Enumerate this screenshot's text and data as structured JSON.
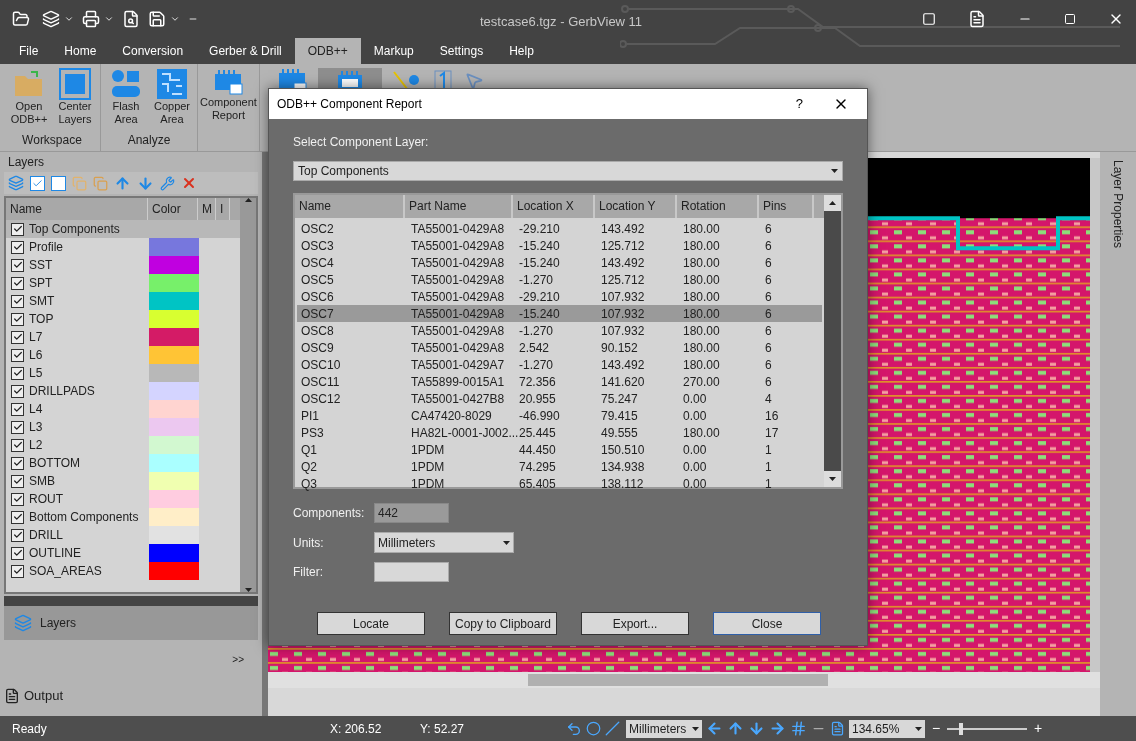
{
  "window": {
    "title": "testcase6.tgz - GerbView 11"
  },
  "ribbon_tabs": [
    {
      "label": "File",
      "selected": false
    },
    {
      "label": "Home",
      "selected": false
    },
    {
      "label": "Conversion",
      "selected": false
    },
    {
      "label": "Gerber & Drill",
      "selected": false
    },
    {
      "label": "ODB++",
      "selected": true
    },
    {
      "label": "Markup",
      "selected": false
    },
    {
      "label": "Settings",
      "selected": false
    },
    {
      "label": "Help",
      "selected": false
    }
  ],
  "ribbon_groups": [
    {
      "label": "Workspace",
      "buttons": [
        {
          "label": "Open ODB++"
        },
        {
          "label": "Center Layers"
        }
      ]
    },
    {
      "label": "Analyze",
      "buttons": [
        {
          "label": "Flash Area"
        },
        {
          "label": "Copper Area"
        }
      ]
    },
    {
      "buttons": [
        {
          "label": "Component Report"
        }
      ]
    }
  ],
  "ribbon_icon_buttons": [
    {
      "selected": false
    },
    {
      "selected": true
    },
    {
      "selected": false
    },
    {
      "selected": false
    },
    {
      "selected": false
    }
  ],
  "layers_panel": {
    "title": "Layers",
    "columns": [
      "Name",
      "Color",
      "M",
      "I"
    ],
    "rows": [
      {
        "name": "Top Components",
        "checked": true,
        "selected": true
      },
      {
        "name": "Profile",
        "checked": true,
        "selected": false,
        "color": "#7777dd"
      },
      {
        "name": "SST",
        "checked": true,
        "selected": false,
        "color": "#c000e0"
      },
      {
        "name": "SPT",
        "checked": true,
        "selected": false,
        "color": "#77f06a"
      },
      {
        "name": "SMT",
        "checked": true,
        "selected": false,
        "color": "#00c4c4"
      },
      {
        "name": "TOP",
        "checked": true,
        "selected": false,
        "color": "#d8ff30"
      },
      {
        "name": "L7",
        "checked": true,
        "selected": false,
        "color": "#d41b66"
      },
      {
        "name": "L6",
        "checked": true,
        "selected": false,
        "color": "#ffc435"
      },
      {
        "name": "L5",
        "checked": true,
        "selected": false,
        "color": "#b8b8b8"
      },
      {
        "name": "DRILLPADS",
        "checked": true,
        "selected": false,
        "color": "#d4d4ff"
      },
      {
        "name": "L4",
        "checked": true,
        "selected": false,
        "color": "#ffd4d0"
      },
      {
        "name": "L3",
        "checked": true,
        "selected": false,
        "color": "#ecc8f0"
      },
      {
        "name": "L2",
        "checked": true,
        "selected": false,
        "color": "#d2f8d0"
      },
      {
        "name": "BOTTOM",
        "checked": true,
        "selected": false,
        "color": "#aaffff"
      },
      {
        "name": "SMB",
        "checked": true,
        "selected": false,
        "color": "#f0ffb0"
      },
      {
        "name": "ROUT",
        "checked": true,
        "selected": false,
        "color": "#ffcce0"
      },
      {
        "name": "Bottom Components",
        "checked": true,
        "selected": false,
        "color": "#ffeec8"
      },
      {
        "name": "DRILL",
        "checked": true,
        "selected": false,
        "color": "#e2e2e2"
      },
      {
        "name": "OUTLINE",
        "checked": true,
        "selected": false,
        "color": "#0000ff"
      },
      {
        "name": "SOA_AREAS",
        "checked": true,
        "selected": false,
        "color": "#ff0000"
      }
    ]
  },
  "nav_panel": {
    "label": "Layers",
    "more": ">>"
  },
  "output_panel": {
    "label": "Output"
  },
  "side_panel": {
    "label": "Layer Properties"
  },
  "dialog": {
    "title": "ODB++ Component Report",
    "help": "?",
    "layer_label": "Select Component Layer:",
    "layer_value": "Top Components",
    "columns": [
      "Name",
      "Part Name",
      "Location X",
      "Location Y",
      "Rotation",
      "Pins"
    ],
    "rows": [
      {
        "cells": [
          "OSC2",
          "TA55001-0429A8",
          "-29.210",
          "143.492",
          "180.00",
          "6"
        ],
        "selected": false
      },
      {
        "cells": [
          "OSC3",
          "TA55001-0429A8",
          "-15.240",
          "125.712",
          "180.00",
          "6"
        ],
        "selected": false
      },
      {
        "cells": [
          "OSC4",
          "TA55001-0429A8",
          "-15.240",
          "143.492",
          "180.00",
          "6"
        ],
        "selected": false
      },
      {
        "cells": [
          "OSC5",
          "TA55001-0429A8",
          "-1.270",
          "125.712",
          "180.00",
          "6"
        ],
        "selected": false
      },
      {
        "cells": [
          "OSC6",
          "TA55001-0429A8",
          "-29.210",
          "107.932",
          "180.00",
          "6"
        ],
        "selected": false
      },
      {
        "cells": [
          "OSC7",
          "TA55001-0429A8",
          "-15.240",
          "107.932",
          "180.00",
          "6"
        ],
        "selected": true
      },
      {
        "cells": [
          "OSC8",
          "TA55001-0429A8",
          "-1.270",
          "107.932",
          "180.00",
          "6"
        ],
        "selected": false
      },
      {
        "cells": [
          "OSC9",
          "TA55001-0429A8",
          "2.542",
          "90.152",
          "180.00",
          "6"
        ],
        "selected": false
      },
      {
        "cells": [
          "OSC10",
          "TA55001-0429A7",
          "-1.270",
          "143.492",
          "180.00",
          "6"
        ],
        "selected": false
      },
      {
        "cells": [
          "OSC11",
          "TA55899-0015A1",
          "72.356",
          "141.620",
          "270.00",
          "6"
        ],
        "selected": false
      },
      {
        "cells": [
          "OSC12",
          "TA55001-0427B8",
          "20.955",
          "75.247",
          "0.00",
          "4"
        ],
        "selected": false
      },
      {
        "cells": [
          "PI1",
          "CA47420-8029",
          "-46.990",
          "79.415",
          "0.00",
          "16"
        ],
        "selected": false
      },
      {
        "cells": [
          "PS3",
          "HA82L-0001-J002...",
          "25.445",
          "49.555",
          "180.00",
          "17"
        ],
        "selected": false
      },
      {
        "cells": [
          "Q1",
          "1PDM",
          "44.450",
          "150.510",
          "0.00",
          "1"
        ],
        "selected": false
      },
      {
        "cells": [
          "Q2",
          "1PDM",
          "74.295",
          "134.938",
          "0.00",
          "1"
        ],
        "selected": false
      },
      {
        "cells": [
          "Q3",
          "1PDM",
          "65.405",
          "138.112",
          "0.00",
          "1"
        ],
        "selected": false
      }
    ],
    "components_label": "Components:",
    "components_value": "442",
    "units_label": "Units:",
    "units_value": "Millimeters",
    "filter_label": "Filter:",
    "buttons": [
      {
        "label": "Locate",
        "default": false
      },
      {
        "label": "Copy to Clipboard",
        "default": false
      },
      {
        "label": "Export...",
        "default": false
      },
      {
        "label": "Close",
        "default": true
      }
    ]
  },
  "status_bar": {
    "status": "Ready",
    "x": "X: 206.52",
    "y": "Y: 52.27",
    "units": "Millimeters",
    "zoom": "134.65%",
    "zoom_out": "−",
    "zoom_in": "+",
    "zoom_slider": {
      "level": 0.15
    }
  }
}
